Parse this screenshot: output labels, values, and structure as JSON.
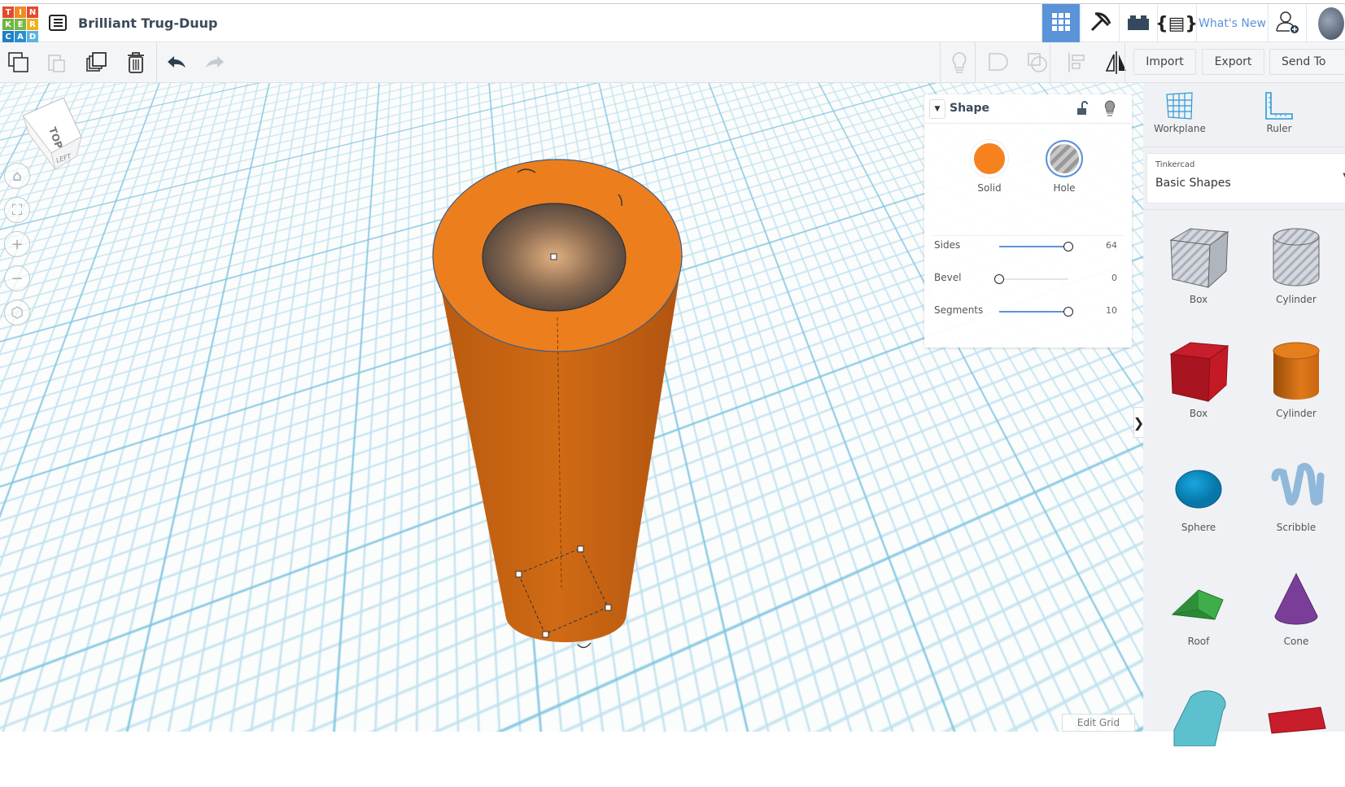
{
  "app": {
    "logo_letters": [
      "T",
      "I",
      "N",
      "K",
      "E",
      "R",
      "C",
      "A",
      "D"
    ],
    "logo_colors": [
      "#e4492e",
      "#f08a24",
      "#e4492e",
      "#6fb744",
      "#7ab844",
      "#f0b023",
      "#1f7fc4",
      "#2a8ed0",
      "#5bb3e0"
    ],
    "project_title": "Brilliant Trug-Duup"
  },
  "topnav": {
    "whats_new": "What's New"
  },
  "toolbar": {
    "import": "Import",
    "export": "Export",
    "send_to": "Send To"
  },
  "viewcube": {
    "top": "TOP",
    "left": "LEFT"
  },
  "inspector": {
    "title": "Shape",
    "solid_label": "Solid",
    "hole_label": "Hole",
    "solid_color": "#f5821f",
    "props": [
      {
        "label": "Sides",
        "value": "64",
        "fraction": 1.0
      },
      {
        "label": "Bevel",
        "value": "0",
        "fraction": 0.0
      },
      {
        "label": "Segments",
        "value": "10",
        "fraction": 1.0
      }
    ]
  },
  "right_panel": {
    "workplane": "Workplane",
    "ruler": "Ruler",
    "library_source": "Tinkercad",
    "library_name": "Basic Shapes",
    "shapes": [
      {
        "label": "Box"
      },
      {
        "label": "Cylinder"
      },
      {
        "label": "Box"
      },
      {
        "label": "Cylinder"
      },
      {
        "label": "Sphere"
      },
      {
        "label": "Scribble"
      },
      {
        "label": "Roof"
      },
      {
        "label": "Cone"
      }
    ]
  },
  "canvas": {
    "edit_grid": "Edit Grid"
  }
}
